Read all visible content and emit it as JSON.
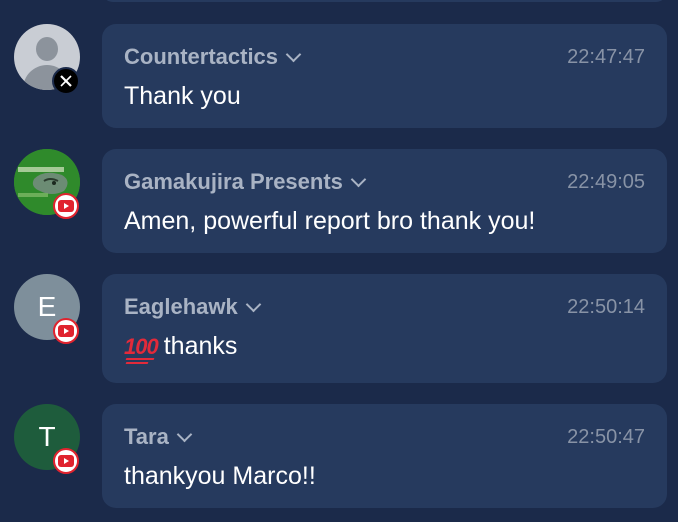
{
  "messages": [
    {
      "author": "Countertactics",
      "time": "22:47:47",
      "text": "Thank you",
      "avatar": "default-user",
      "platform": "x-icon"
    },
    {
      "author": "Gamakujira Presents",
      "time": "22:49:05",
      "text": "Amen, powerful report bro thank you!",
      "avatar": "image",
      "platform": "youtube-icon"
    },
    {
      "author": "Eaglehawk",
      "time": "22:50:14",
      "emoji": "💯",
      "text": "thanks",
      "avatar": "letter",
      "avatar_letter": "E",
      "platform": "youtube-icon"
    },
    {
      "author": "Tara",
      "time": "22:50:47",
      "text": "thankyou Marco!!",
      "avatar": "letter",
      "avatar_letter": "T",
      "platform": "youtube-icon"
    }
  ],
  "colors": {
    "background": "#1b2a4a",
    "bubble": "#263a5e",
    "author": "#a9b3c4",
    "timestamp": "#8893a6",
    "text": "#ffffff",
    "youtube_red": "#e0232e"
  }
}
